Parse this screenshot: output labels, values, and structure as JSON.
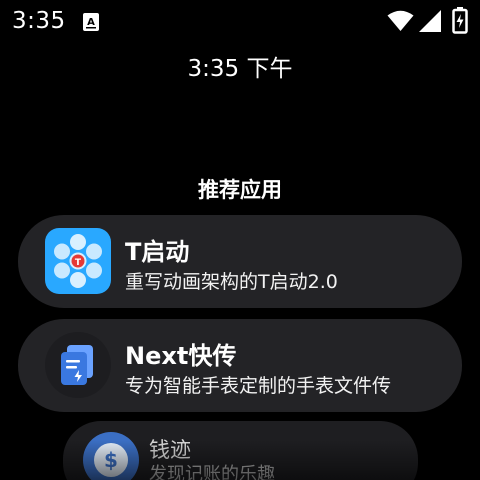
{
  "status_bar": {
    "time": "3:35",
    "notification_icon": "a-letter-notification-icon",
    "wifi_icon": "wifi-icon",
    "signal_icon": "cell-signal-icon",
    "battery_icon": "battery-charging-icon"
  },
  "clock": {
    "text": "3:35 下午"
  },
  "section": {
    "title": "推荐应用"
  },
  "apps": [
    {
      "name": "T启动",
      "description": "重写动画架构的T启动2.0",
      "icon": "t-launcher-icon"
    },
    {
      "name": "Next快传",
      "description": "专为智能手表定制的手表文件传",
      "icon": "next-transfer-icon"
    },
    {
      "name": "钱迹",
      "description": "发现记账的乐趣",
      "icon": "qianji-dollar-icon"
    }
  ],
  "colors": {
    "background": "#000000",
    "card": "#232326",
    "t_icon_bg": "#29a8ff",
    "next_icon_bg": "#3a78e0",
    "qianji_icon_bg": "#3b6fc4"
  }
}
